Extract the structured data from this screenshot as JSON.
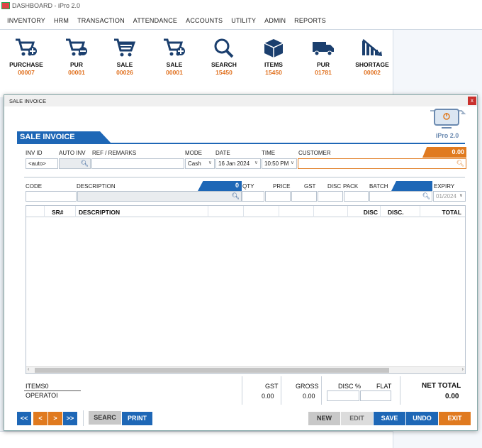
{
  "app": {
    "title": "DASHBOARD - iPro 2.0"
  },
  "menu": [
    "INVENTORY",
    "HRM",
    "TRANSACTION",
    "ATTENDANCE",
    "ACCOUNTS",
    "UTILITY",
    "ADMIN",
    "REPORTS"
  ],
  "tiles": [
    {
      "label": "PURCHASE",
      "count": "00007",
      "icon": "cart-plus-icon"
    },
    {
      "label": "PUR",
      "count": "00001",
      "icon": "cart-minus-icon"
    },
    {
      "label": "SALE",
      "count": "00026",
      "icon": "cart-icon"
    },
    {
      "label": "SALE",
      "count": "00001",
      "icon": "cart-plus-icon"
    },
    {
      "label": "SEARCH",
      "count": "15450",
      "icon": "search-icon"
    },
    {
      "label": "ITEMS",
      "count": "15450",
      "icon": "box-icon"
    },
    {
      "label": "PUR",
      "count": "01781",
      "icon": "truck-icon"
    },
    {
      "label": "SHORTAGE",
      "count": "00002",
      "icon": "chart-down-icon"
    }
  ],
  "window": {
    "title": "SALE INVOICE",
    "close": "x",
    "banner": "SALE INVOICE",
    "logo_text": "iPro 2.0"
  },
  "header": {
    "labels": {
      "inv_id": "INV ID",
      "auto_inv": "AUTO INV",
      "ref": "REF / REMARKS",
      "mode": "MODE",
      "date": "DATE",
      "time": "TIME",
      "customer": "CUSTOMER"
    },
    "inv_id_value": "<auto>",
    "mode_value": "Cash",
    "date_value": "16  Jan  2024",
    "time_value": "10:50 PM",
    "customer_balance": "0.00"
  },
  "item_entry": {
    "labels": {
      "code": "CODE",
      "description": "DESCRIPTION",
      "qty": "QTY",
      "price": "PRICE",
      "gst": "GST",
      "disc": "DISC",
      "pack": "PACK",
      "batch": "BATCH",
      "expiry": "EXPIRY"
    },
    "desc_count": "0",
    "expiry_value": "01/2024"
  },
  "grid": {
    "columns": [
      "SR#",
      "DESCRIPTION",
      "",
      "",
      "",
      "",
      "DISC",
      "DISC.",
      "TOTAL"
    ]
  },
  "totals": {
    "items_label": "ITEMS",
    "items_value": "0",
    "operator_label": "OPERATOI",
    "gst_label": "GST",
    "gst_value": "0.00",
    "gross_label": "GROSS",
    "gross_value": "0.00",
    "disc_pct_label": "DISC %",
    "flat_label": "FLAT",
    "net_total_label": "NET TOTAL",
    "net_total_value": "0.00"
  },
  "buttons": {
    "first": "<<",
    "prev": "<",
    "next": ">",
    "last": ">>",
    "search": "SEARC",
    "print": "PRINT",
    "new": "NEW",
    "edit": "EDIT",
    "save": "SAVE",
    "undo": "UNDO",
    "exit": "EXIT"
  },
  "colors": {
    "primary": "#1e67b6",
    "accent": "#e07a1f"
  }
}
